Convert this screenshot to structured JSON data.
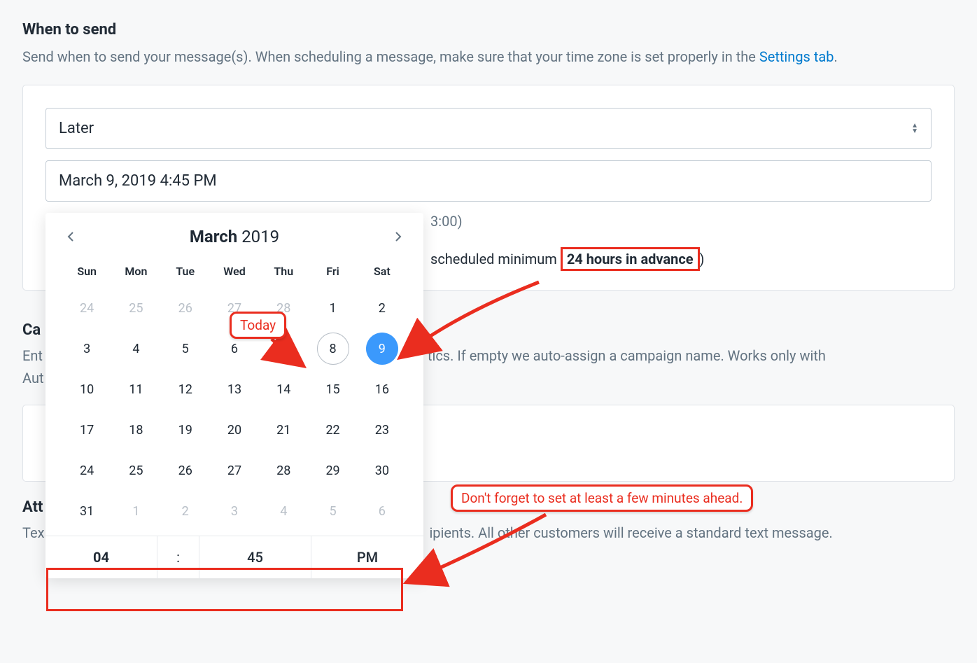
{
  "header": {
    "title": "When to send",
    "description_prefix": "Send when to send your message(s). When scheduling a message, make sure that your time zone is set properly in the ",
    "settings_link": "Settings tab",
    "description_suffix": "."
  },
  "form": {
    "when_select_value": "Later",
    "datetime_value": "March 9, 2019 4:45 PM",
    "tz_fragment": "3:00)",
    "hint_prefix": "scheduled minimum ",
    "hint_highlight": "24 hours in advance",
    "hint_suffix": ")"
  },
  "calendar": {
    "month": "March",
    "year": "2019",
    "dow": [
      "Sun",
      "Mon",
      "Tue",
      "Wed",
      "Thu",
      "Fri",
      "Sat"
    ],
    "rows": [
      [
        {
          "n": "24",
          "o": true
        },
        {
          "n": "25",
          "o": true
        },
        {
          "n": "26",
          "o": true
        },
        {
          "n": "27",
          "o": true
        },
        {
          "n": "28",
          "o": true
        },
        {
          "n": "1"
        },
        {
          "n": "2"
        }
      ],
      [
        {
          "n": "3"
        },
        {
          "n": "4"
        },
        {
          "n": "5"
        },
        {
          "n": "6"
        },
        {
          "n": "7"
        },
        {
          "n": "8",
          "today": true
        },
        {
          "n": "9",
          "selected": true
        }
      ],
      [
        {
          "n": "10"
        },
        {
          "n": "11"
        },
        {
          "n": "12"
        },
        {
          "n": "13"
        },
        {
          "n": "14"
        },
        {
          "n": "15"
        },
        {
          "n": "16"
        }
      ],
      [
        {
          "n": "17"
        },
        {
          "n": "18"
        },
        {
          "n": "19"
        },
        {
          "n": "20"
        },
        {
          "n": "21"
        },
        {
          "n": "22"
        },
        {
          "n": "23"
        }
      ],
      [
        {
          "n": "24"
        },
        {
          "n": "25"
        },
        {
          "n": "26"
        },
        {
          "n": "27"
        },
        {
          "n": "28"
        },
        {
          "n": "29"
        },
        {
          "n": "30"
        }
      ],
      [
        {
          "n": "31"
        },
        {
          "n": "1",
          "o": true
        },
        {
          "n": "2",
          "o": true
        },
        {
          "n": "3",
          "o": true
        },
        {
          "n": "4",
          "o": true
        },
        {
          "n": "5",
          "o": true
        },
        {
          "n": "6",
          "o": true
        }
      ]
    ],
    "time": {
      "hour": "04",
      "sep": ":",
      "minute": "45",
      "ampm": "PM"
    }
  },
  "annotations": {
    "today": "Today",
    "ahead": "Don't forget to set at least a few minutes ahead."
  },
  "sections": {
    "campaign_title_frag": "Ca",
    "campaign_desc1_frag": "Ent",
    "campaign_desc2_frag": "Aut",
    "campaign_desc_right": "tics. If empty we auto-assign a campaign name. Works only with",
    "attachment_title_frag": "Att",
    "attachment_desc_frag": "Tex",
    "attachment_desc_right": "ipients. All other customers will receive a standard text message."
  }
}
